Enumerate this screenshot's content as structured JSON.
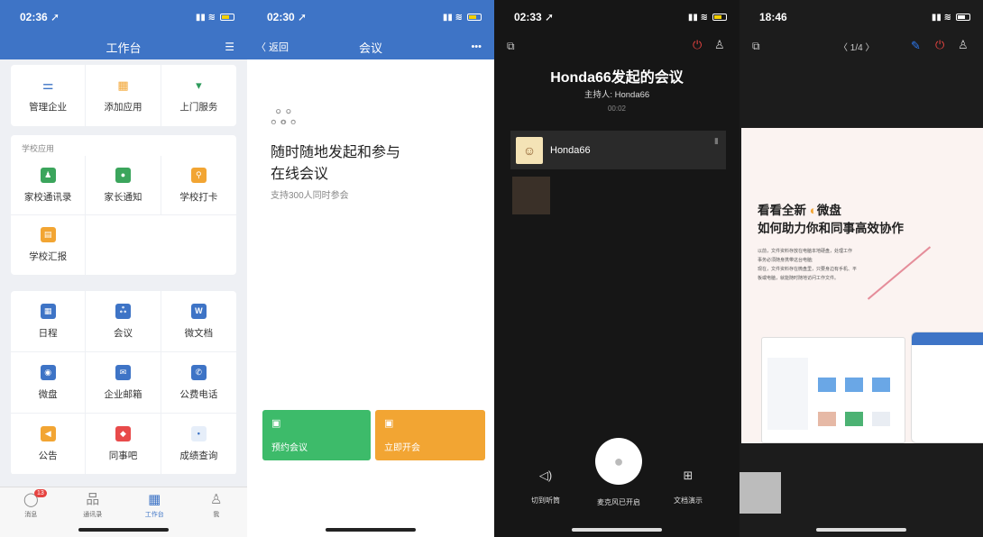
{
  "screen1": {
    "status_time": "02:36 ➚",
    "nav_title": "工作台",
    "top_items": [
      {
        "label": "管理企业",
        "icon": "sliders-icon",
        "color": "#3e74c6",
        "glyph": "⚌"
      },
      {
        "label": "添加应用",
        "icon": "add-app-icon",
        "color": "#f2a533",
        "glyph": "▦"
      },
      {
        "label": "上门服务",
        "icon": "tie-icon",
        "color": "#2e9b5c",
        "glyph": "▾"
      }
    ],
    "school_title": "学校应用",
    "school_items": [
      {
        "label": "家校通讯录",
        "icon": "contacts-icon",
        "color": "#3ba55c",
        "glyph": "👤"
      },
      {
        "label": "家长通知",
        "icon": "chat-icon",
        "color": "#3ba55c",
        "glyph": "●"
      },
      {
        "label": "学校打卡",
        "icon": "location-icon",
        "color": "#f2a533",
        "glyph": "⚲"
      },
      {
        "label": "学校汇报",
        "icon": "report-icon",
        "color": "#f2a533",
        "glyph": "▤"
      }
    ],
    "apps": [
      {
        "label": "日程",
        "icon": "calendar-icon",
        "color": "#3e74c6",
        "glyph": "▦"
      },
      {
        "label": "会议",
        "icon": "meeting-icon",
        "color": "#3e74c6",
        "glyph": "ஃ"
      },
      {
        "label": "微文档",
        "icon": "doc-icon",
        "color": "#3e74c6",
        "glyph": "W"
      },
      {
        "label": "微盘",
        "icon": "drive-icon",
        "color": "#3e74c6",
        "glyph": "◉"
      },
      {
        "label": "企业邮箱",
        "icon": "mail-icon",
        "color": "#3e74c6",
        "glyph": "✉"
      },
      {
        "label": "公费电话",
        "icon": "phone-icon",
        "color": "#3e74c6",
        "glyph": "✆"
      },
      {
        "label": "公告",
        "icon": "announce-icon",
        "color": "#f2a533",
        "glyph": "◀"
      },
      {
        "label": "同事吧",
        "icon": "diamond-icon",
        "color": "#e84a4a",
        "glyph": "◆"
      },
      {
        "label": "成绩查询",
        "icon": "score-icon",
        "color": "#e6eef9",
        "glyph": "•"
      }
    ],
    "tabs": [
      {
        "label": "消息",
        "icon": "message-icon",
        "glyph": "◯",
        "badge": "13"
      },
      {
        "label": "通讯录",
        "icon": "org-icon",
        "glyph": "品"
      },
      {
        "label": "工作台",
        "icon": "grid-icon",
        "glyph": "▦",
        "active": true
      },
      {
        "label": "我",
        "icon": "person-icon",
        "glyph": "♙"
      }
    ]
  },
  "screen2": {
    "status_time": "02:30 ➚",
    "back": "〈 返回",
    "nav_title": "会议",
    "more": "•••",
    "headline_1": "随时随地发起和参与",
    "headline_2": "在线会议",
    "sub": "支持300人同时参会",
    "btn_schedule": "预约会议",
    "btn_start": "立即开会"
  },
  "screen3": {
    "status_time": "02:33 ➚",
    "title": "Honda66发起的会议",
    "host": "主持人: Honda66",
    "timer": "00:02",
    "participant": "Honda66",
    "actions": [
      {
        "label": "切到听筒",
        "icon": "speaker-icon",
        "glyph": "◁)"
      },
      {
        "label": "麦克风已开启",
        "icon": "mic-icon",
        "glyph": "🎙"
      },
      {
        "label": "文档演示",
        "icon": "share-doc-icon",
        "glyph": "⊞"
      }
    ]
  },
  "screen4": {
    "status_time": "18:46",
    "pager": "〈  1/4  〉",
    "slide_title_1": "看看全新",
    "slide_brand": "微盘",
    "slide_title_2": "如何助力你和同事高效协作",
    "slide_text": [
      "以前，文件资料存放在电脑本地硬盘，处理工作",
      "事务必须随身携带这台电脑;",
      "现在，文件资料存在微盘里，只要身边有手机、平",
      "板或电脑，就能随时随地访问工作文件。"
    ]
  }
}
